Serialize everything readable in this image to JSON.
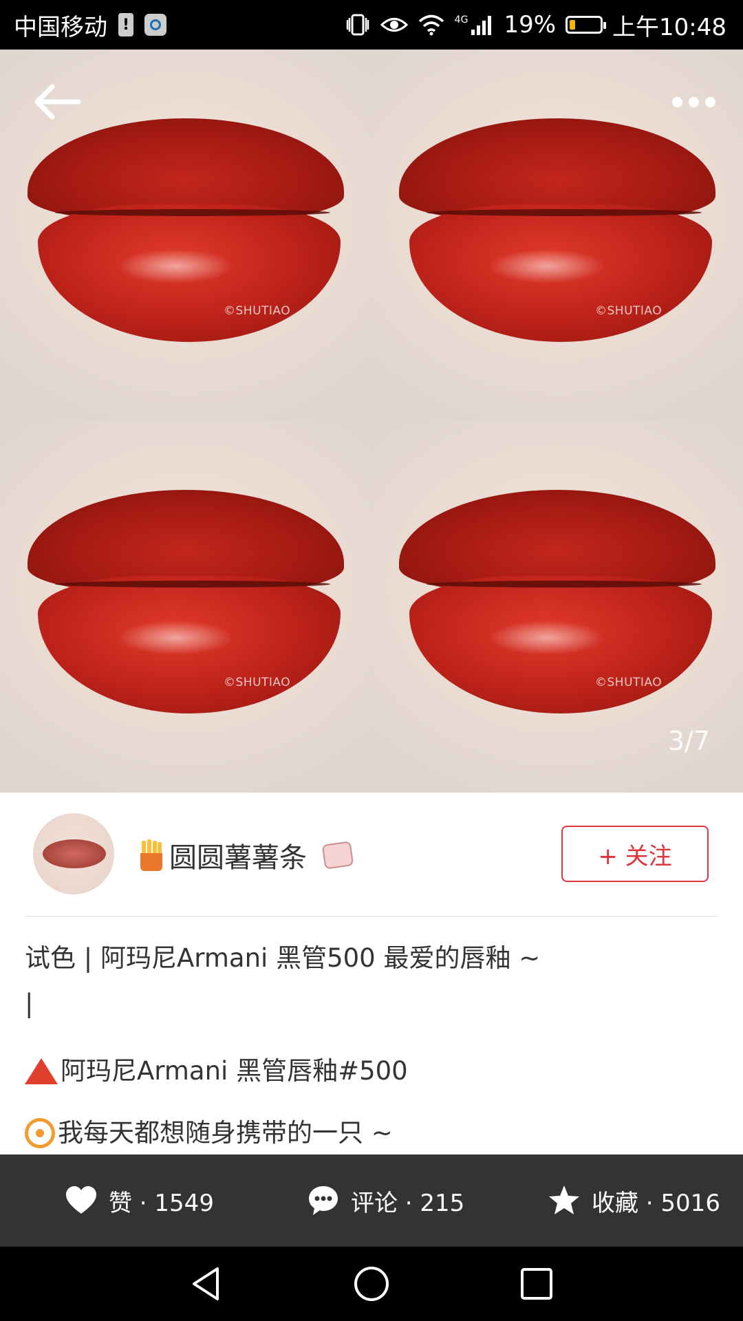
{
  "status_bar": {
    "carrier": "中国移动",
    "network_type": "4G",
    "battery_percent": "19%",
    "battery_level": 0.19,
    "time": "上午10:48"
  },
  "photo": {
    "watermark": "©SHUTIAO",
    "page_indicator": "3/7",
    "lip_color": "#c0231a"
  },
  "author": {
    "name": "圆圆薯薯条",
    "follow_label": "+ 关注",
    "accent_color": "#e0343c"
  },
  "post": {
    "title": "试色 | 阿玛尼Armani 黑管500   最爱的唇釉 ~",
    "caret": "|",
    "line1": "阿玛尼Armani 黑管唇釉#500",
    "line2": "我每天都想随身携带的一只 ~"
  },
  "actions": {
    "like": "赞 · 1549",
    "comment": "评论 · 215",
    "collect": "收藏 · 5016"
  },
  "icons": [
    "back-arrow-icon",
    "more-icon",
    "heart-icon",
    "comment-icon",
    "star-icon",
    "fries-icon",
    "soap-icon",
    "triangle-icon",
    "target-icon"
  ]
}
